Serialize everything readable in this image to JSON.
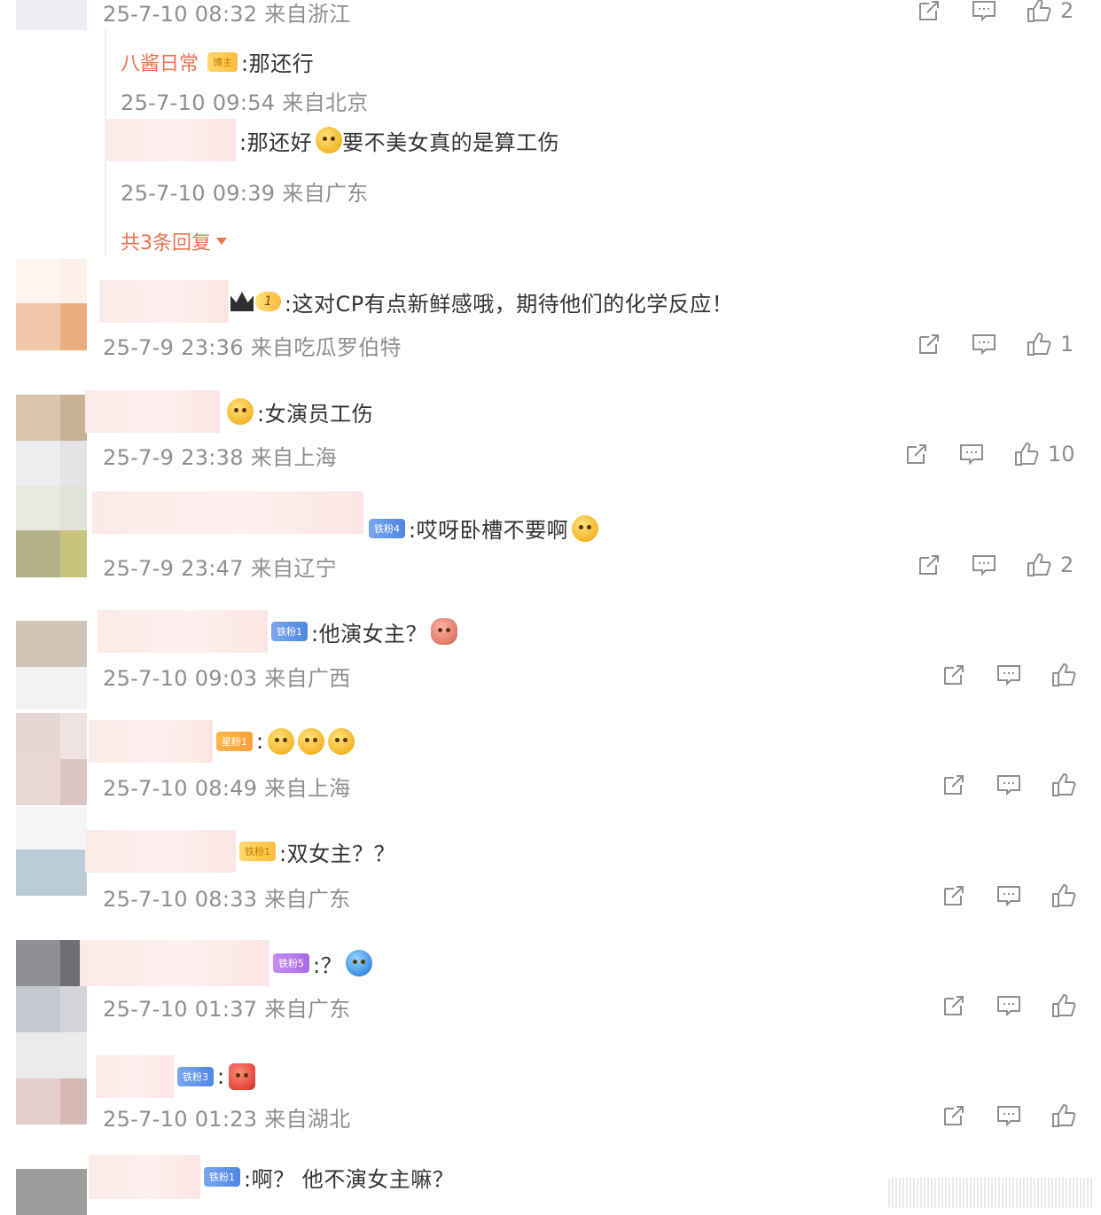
{
  "colors": {
    "accent": "#eb7350",
    "meta": "#8f8f8f",
    "text": "#333333"
  },
  "top_comment": {
    "time": "25-7-10 08:32 来自浙江",
    "like_count": "2",
    "replies": [
      {
        "name": "八酱日常",
        "badge": "博主",
        "text": ":那还行",
        "time": "25-7-10 09:54 来自北京"
      },
      {
        "name": "",
        "text": ":那还好",
        "text_after": "要不美女真的是算工伤",
        "time": "25-7-10 09:39 来自广东"
      }
    ],
    "more_replies": "共3条回复"
  },
  "comments": [
    {
      "text": ":这对CP有点新鲜感哦，期待他们的化学反应！",
      "crown_level": "1",
      "time": "25-7-9 23:36 来自吃瓜罗伯特",
      "like_count": "1"
    },
    {
      "text": ":女演员工伤",
      "time": "25-7-9 23:38 来自上海",
      "like_count": "10"
    },
    {
      "text": ":哎呀卧槽不要啊",
      "badge": "铁粉4",
      "time": "25-7-9 23:47 来自辽宁",
      "like_count": "2"
    },
    {
      "text": ":他演女主？",
      "badge": "铁粉1",
      "time": "25-7-10 09:03 来自广西",
      "like_count": ""
    },
    {
      "text": ":",
      "badge": "星粉1",
      "time": "25-7-10 08:49 来自上海",
      "like_count": ""
    },
    {
      "text": ":双女主？？",
      "badge": "铁粉1",
      "time": "25-7-10 08:33 来自广东",
      "like_count": ""
    },
    {
      "text": ":？",
      "badge": "铁粉5",
      "time": "25-7-10 01:37 来自广东",
      "like_count": ""
    },
    {
      "text": ":",
      "badge": "铁粉3",
      "time": "25-7-10 01:23 来自湖北",
      "like_count": ""
    },
    {
      "text": ":啊？ 他不演女主嘛？",
      "badge": "铁粉1",
      "time": "",
      "like_count": ""
    }
  ],
  "icons": {
    "share": "share-icon",
    "comment": "comment-icon",
    "like": "like-icon"
  }
}
